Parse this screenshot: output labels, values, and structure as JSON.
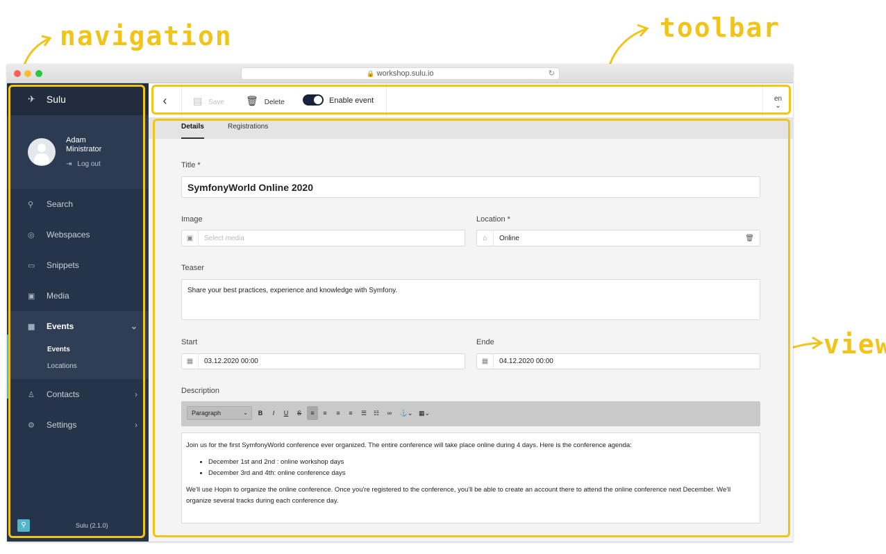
{
  "annotations": {
    "navigation": "navigation",
    "toolbar": "toolbar",
    "view": "view"
  },
  "browser": {
    "url": "workshop.sulu.io"
  },
  "nav": {
    "app_name": "Sulu",
    "user": {
      "first": "Adam",
      "last": "Ministrator",
      "logout": "Log out"
    },
    "items": [
      {
        "label": "Search",
        "icon": "search-icon"
      },
      {
        "label": "Webspaces",
        "icon": "target-icon"
      },
      {
        "label": "Snippets",
        "icon": "note-icon"
      },
      {
        "label": "Media",
        "icon": "image-icon"
      },
      {
        "label": "Events",
        "icon": "calendar-icon",
        "expanded": true,
        "children": [
          {
            "label": "Events",
            "active": true
          },
          {
            "label": "Locations"
          }
        ]
      },
      {
        "label": "Contacts",
        "icon": "person-icon"
      },
      {
        "label": "Settings",
        "icon": "gear-icon"
      }
    ],
    "version": "Sulu (2.1.0)",
    "accent": "#52b6ca"
  },
  "toolbar": {
    "save": "Save",
    "delete": "Delete",
    "enable_event": "Enable event",
    "enable_event_on": true,
    "locale": "en"
  },
  "tabs": [
    {
      "label": "Details",
      "active": true
    },
    {
      "label": "Registrations"
    }
  ],
  "form": {
    "title_label": "Title *",
    "title_value": "SymfonyWorld Online 2020",
    "image_label": "Image",
    "image_placeholder": "Select media",
    "location_label": "Location *",
    "location_value": "Online",
    "teaser_label": "Teaser",
    "teaser_value": "Share your best practices, experience and knowledge with Symfony.",
    "start_label": "Start",
    "start_value": "03.12.2020 00:00",
    "end_label": "Ende",
    "end_value": "04.12.2020 00:00",
    "description_label": "Description",
    "editor_format": "Paragraph",
    "description": {
      "intro": "Join us for the first SymfonyWorld conference ever organized. The entire conference will take place online during 4 days. Here is the conference agenda:",
      "bullets": [
        "December 1st and 2nd : online workshop days",
        "December 3rd and 4th: online conference days"
      ],
      "outro": "We'll use Hopin to organize the online conference. Once you're registered to the conference, you'll be able to create an account there to attend the online conference next December. We'll organize several tracks during each conference day."
    }
  },
  "colors": {
    "annotation": "#f0c419",
    "nav_bg": "#263449",
    "toggle_on": "#16233a"
  }
}
